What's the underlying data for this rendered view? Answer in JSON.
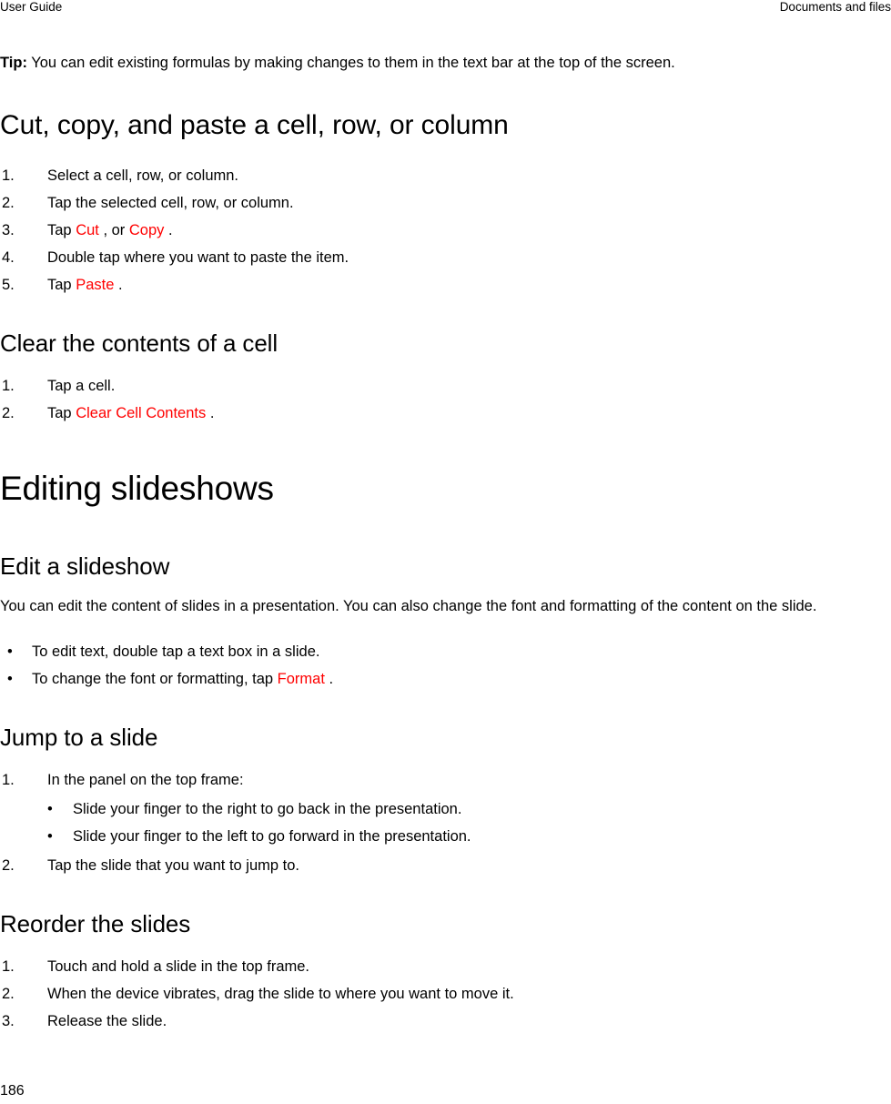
{
  "header": {
    "left": "User Guide",
    "right": "Documents and files"
  },
  "footer": {
    "page_number": "186"
  },
  "colors": {
    "ui_label_red": "#ff0000",
    "text": "#000000",
    "background": "#ffffff"
  },
  "tip": {
    "label": "Tip:",
    "text": " You can edit existing formulas by making changes to them in the text bar at the top of the screen."
  },
  "section_cut_copy_paste": {
    "title": "Cut, copy, and paste a cell, row, or column",
    "steps": [
      {
        "num": "1.",
        "pre": "Select a cell, row, or column.",
        "label": "",
        "post": ""
      },
      {
        "num": "2.",
        "pre": "Tap the selected cell, row, or column.",
        "label": "",
        "post": ""
      },
      {
        "num": "3.",
        "pre": "Tap ",
        "label": "Cut",
        "post": " , or ",
        "label2": "Copy",
        "post2": " ."
      },
      {
        "num": "4.",
        "pre": "Double tap where you want to paste the item.",
        "label": "",
        "post": ""
      },
      {
        "num": "5.",
        "pre": "Tap ",
        "label": "Paste",
        "post": " ."
      }
    ]
  },
  "section_clear_cell": {
    "title": "Clear the contents of a cell",
    "steps": [
      {
        "num": "1.",
        "pre": "Tap a cell.",
        "label": "",
        "post": ""
      },
      {
        "num": "2.",
        "pre": "Tap ",
        "label": "Clear Cell Contents",
        "post": " ."
      }
    ]
  },
  "chapter_editing_slideshows": {
    "title": "Editing slideshows"
  },
  "section_edit_slideshow": {
    "title": "Edit a slideshow",
    "paragraph": "You can edit the content of slides in a presentation. You can also change the font and formatting of the content on the slide.",
    "bullets": [
      {
        "pre": "To edit text, double tap a text box in a slide.",
        "label": "",
        "post": ""
      },
      {
        "pre": "To change the font or formatting, tap ",
        "label": "Format",
        "post": " ."
      }
    ]
  },
  "section_jump_to_slide": {
    "title": "Jump to a slide",
    "step1": {
      "num": "1.",
      "text": "In the panel on the top frame:"
    },
    "substeps": [
      "Slide your finger to the right to go back in the presentation.",
      "Slide your finger to the left to go forward in the presentation."
    ],
    "step2": {
      "num": "2.",
      "text": "Tap the slide that you want to jump to."
    }
  },
  "section_reorder_slides": {
    "title": "Reorder the slides",
    "steps": [
      {
        "num": "1.",
        "text": "Touch and hold a slide in the top frame."
      },
      {
        "num": "2.",
        "text": "When the device vibrates, drag the slide to where you want to move it."
      },
      {
        "num": "3.",
        "text": "Release the slide."
      }
    ]
  }
}
